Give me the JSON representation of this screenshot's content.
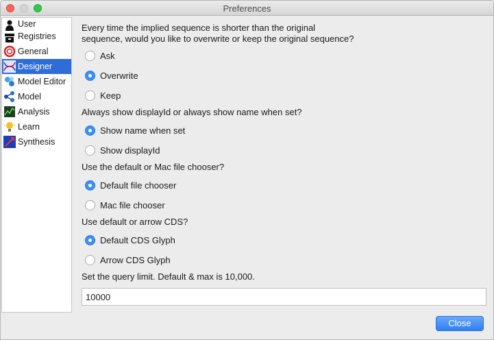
{
  "window": {
    "title": "Preferences"
  },
  "sidebar": {
    "items": [
      {
        "label": "User",
        "icon": "user-icon",
        "selected": false
      },
      {
        "label": "Registries",
        "icon": "registries-icon",
        "selected": false
      },
      {
        "label": "General",
        "icon": "general-icon",
        "selected": false
      },
      {
        "label": "Designer",
        "icon": "designer-icon",
        "selected": true
      },
      {
        "label": "Model Editor",
        "icon": "model-editor-icon",
        "selected": false
      },
      {
        "label": "Model",
        "icon": "model-icon",
        "selected": false
      },
      {
        "label": "Analysis",
        "icon": "analysis-icon",
        "selected": false
      },
      {
        "label": "Learn",
        "icon": "learn-icon",
        "selected": false
      },
      {
        "label": "Synthesis",
        "icon": "synthesis-icon",
        "selected": false
      }
    ]
  },
  "designer": {
    "q1": {
      "line1": "Every time the implied sequence is shorter than the original",
      "line2": "sequence, would you like to overwrite or keep the original sequence?",
      "options": [
        "Ask",
        "Overwrite",
        "Keep"
      ],
      "selected": "Overwrite"
    },
    "q2": {
      "text": "Always show displayId or always show name when set?",
      "options": [
        "Show name when set",
        "Show displayId"
      ],
      "selected": "Show name when set"
    },
    "q3": {
      "text": "Use the default or Mac file chooser?",
      "options": [
        "Default file chooser",
        "Mac file chooser"
      ],
      "selected": "Default file chooser"
    },
    "q4": {
      "text": "Use default or arrow CDS?",
      "options": [
        "Default CDS Glyph",
        "Arrow CDS Glyph"
      ],
      "selected": "Default CDS Glyph"
    },
    "query_limit": {
      "text": "Set the query limit. Default & max is 10,000.",
      "value": "10000"
    }
  },
  "footer": {
    "close_label": "Close"
  },
  "colors": {
    "accent": "#2f6dd6",
    "radio_on": "#3b8ff5",
    "button": "#2f7ff3"
  }
}
